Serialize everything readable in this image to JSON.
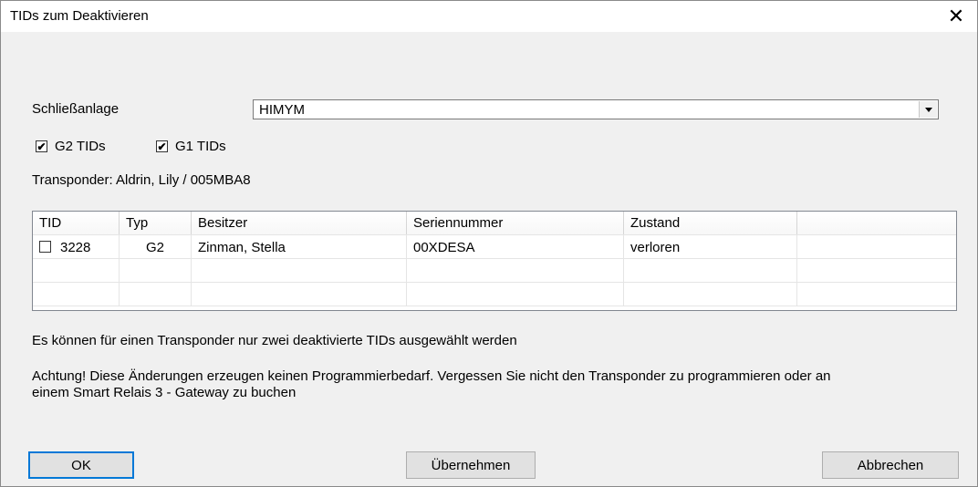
{
  "window": {
    "title": "TIDs zum Deaktivieren",
    "close_glyph": "✕"
  },
  "locking_system": {
    "label": "Schließanlage",
    "value": "HIMYM"
  },
  "filters": {
    "g2": {
      "label": "G2 TIDs",
      "checked": true
    },
    "g1": {
      "label": "G1 TIDs",
      "checked": true
    }
  },
  "transponder_info": "Transponder: Aldrin, Lily / 005MBA8",
  "table": {
    "columns": [
      "TID",
      "Typ",
      "Besitzer",
      "Seriennummer",
      "Zustand",
      ""
    ],
    "rows": [
      {
        "tid": "3228",
        "checked": false,
        "typ": "G2",
        "besitzer": "Zinman, Stella",
        "seriennummer": "00XDESA",
        "zustand": "verloren"
      }
    ]
  },
  "notes": {
    "limit": "Es können für einen Transponder nur zwei deaktivierte TIDs ausgewählt werden",
    "warning_line1": "Achtung! Diese Änderungen erzeugen keinen Programmierbedarf. Vergessen Sie nicht den Transponder zu  programmieren oder an",
    "warning_line2": "einem Smart Relais 3 - Gateway zu buchen"
  },
  "buttons": {
    "ok": "OK",
    "apply": "Übernehmen",
    "cancel": "Abbrechen"
  },
  "colors": {
    "focus_border": "#0078d7",
    "button_bg": "#e1e1e1",
    "window_bg": "#f0f0f0"
  }
}
